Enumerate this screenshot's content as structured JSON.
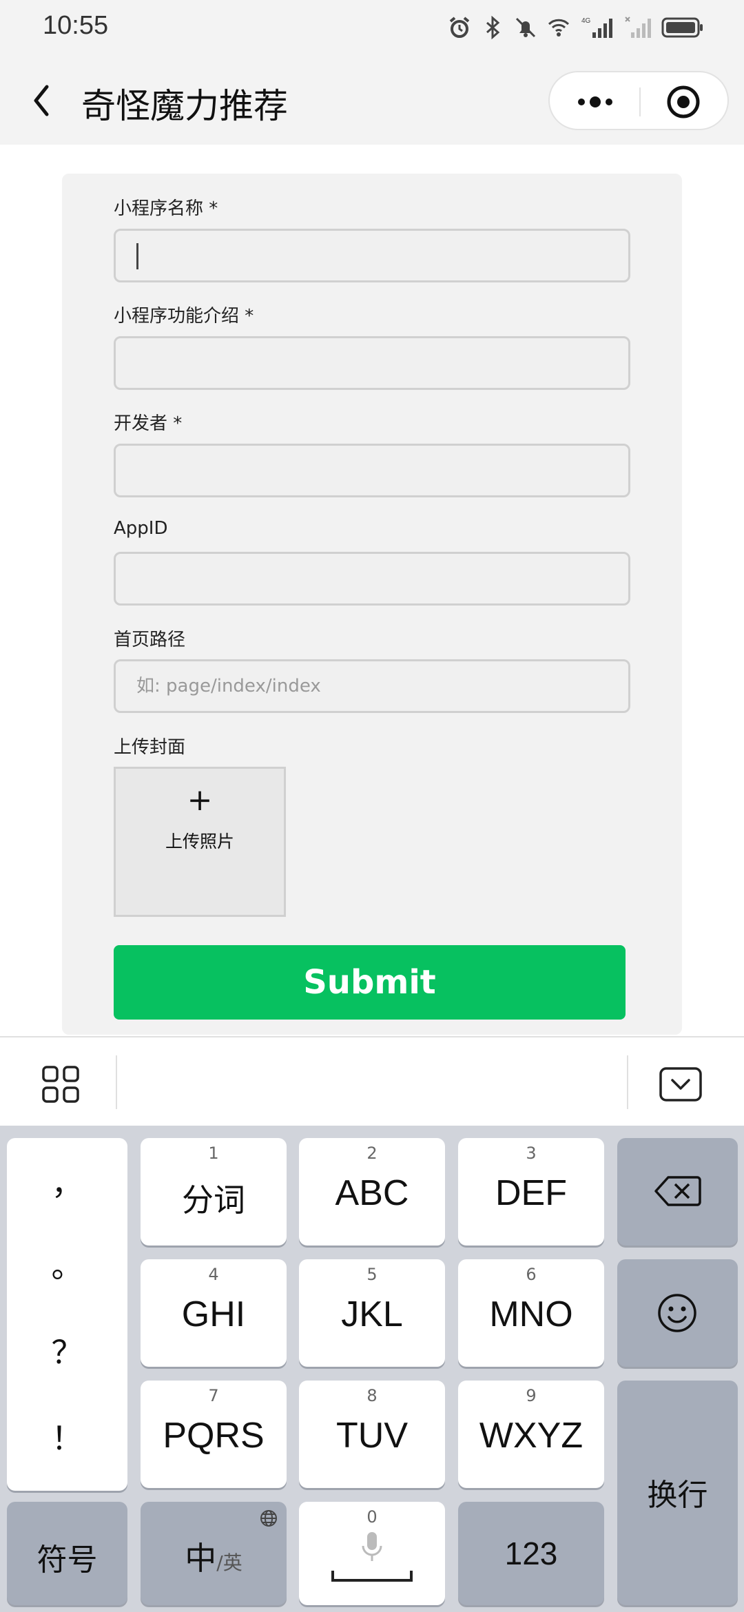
{
  "status_bar": {
    "time": "10:55",
    "network": "4G"
  },
  "nav": {
    "title": "奇怪魔力推荐"
  },
  "form": {
    "fields": [
      {
        "label": "小程序名称 *",
        "value": "",
        "placeholder": ""
      },
      {
        "label": "小程序功能介绍 *",
        "value": "",
        "placeholder": ""
      },
      {
        "label": "开发者 *",
        "value": "",
        "placeholder": ""
      },
      {
        "label": "AppID",
        "value": "",
        "placeholder": ""
      },
      {
        "label": "首页路径",
        "value": "",
        "placeholder": "如: page/index/index"
      }
    ],
    "upload": {
      "label": "上传封面",
      "plus": "+",
      "button_text": "上传照片"
    },
    "submit_label": "Submit"
  },
  "keyboard": {
    "punctuation": [
      "，",
      "。",
      "？",
      "！"
    ],
    "keys": [
      {
        "num": "1",
        "label": "分词"
      },
      {
        "num": "2",
        "label": "ABC"
      },
      {
        "num": "3",
        "label": "DEF"
      },
      {
        "num": "4",
        "label": "GHI"
      },
      {
        "num": "5",
        "label": "JKL"
      },
      {
        "num": "6",
        "label": "MNO"
      },
      {
        "num": "7",
        "label": "PQRS"
      },
      {
        "num": "8",
        "label": "TUV"
      },
      {
        "num": "9",
        "label": "WXYZ"
      }
    ],
    "symbols_label": "符号",
    "lang_main": "中",
    "lang_sub": "/英",
    "space_num": "0",
    "numbers_label": "123",
    "enter_label": "换行"
  },
  "colors": {
    "accent": "#07c160",
    "keyboard_bg": "#d1d4db",
    "dark_key": "#a6adba"
  }
}
